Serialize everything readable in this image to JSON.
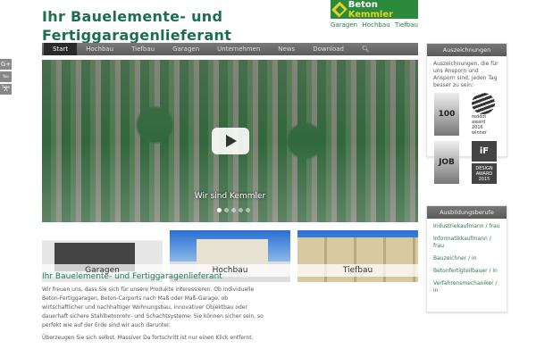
{
  "header": {
    "title_line1": "Ihr Bauelemente- und",
    "title_line2": "Fertiggaragenlieferant",
    "logo_text_a": "Beton",
    "logo_text_b": "Kemmler",
    "links": [
      "Garagen",
      "Hochbau",
      "Tiefbau"
    ]
  },
  "nav": {
    "items": [
      "Start",
      "Hochbau",
      "Tiefbau",
      "Garagen",
      "Unternehmen",
      "News",
      "Download"
    ],
    "search_icon": "search-icon"
  },
  "social": [
    "G+",
    "You Tube",
    "X"
  ],
  "hero": {
    "caption": "Wir sind Kemmler",
    "slides": 5,
    "active_slide": 1
  },
  "tiles": [
    "Garagen",
    "Hochbau",
    "Tiefbau"
  ],
  "main": {
    "heading": "Ihr Bauelemente- und Fertiggaragenlieferant",
    "paragraph": "Wir freuen uns, dass Sie sich für unsere Produkte interessieren. Ob individuelle Beton-Fertiggaragen, Beton-Carports nach Maß oder Maß-Garage, ob wirtschaftlicher und nachhaltiger Wohnungsbau, innovativer Objektbau oder dauerhaft sichere Stahlbetonrohr- und Schachtsysteme: Sie können sicher sein, so perfekt wie auf der Erde sind wir auch darunter.",
    "paragraph2": "Überzeugen Sie sich selbst. Massiver Da fortschritt ist nur einen Klick entfernt."
  },
  "awards": {
    "title": "Auszeichnungen",
    "text": "Auszeichnungen, die für uns Ansporn und Ansporn sind, jeden Tag besser zu sein:",
    "badge1": "100",
    "reddot": "reddot award 2016 winner",
    "badge2": "JOB",
    "if_label": "iF",
    "design": "DESIGN AWARD 2015"
  },
  "training": {
    "title": "Ausbildungsberufe",
    "items": [
      "Industriekaufmann / frau",
      "Informatikkaufmann / frau",
      "Bauzeichner / in",
      "Betonfertigteilbauer / in",
      "Verfahrensmechaniker / in"
    ]
  }
}
